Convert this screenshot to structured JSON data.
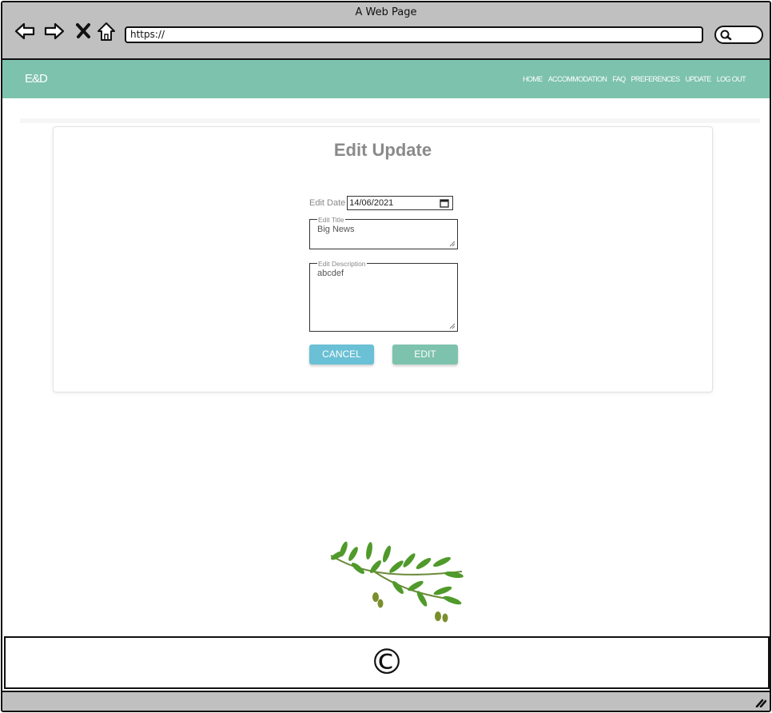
{
  "window": {
    "title": "A Web Page"
  },
  "browser": {
    "url": "https://",
    "icons": [
      "back-arrow-icon",
      "forward-arrow-icon",
      "close-x-icon",
      "home-icon",
      "search-icon"
    ]
  },
  "navbar": {
    "brand": "E&D",
    "items": [
      {
        "label": "HOME"
      },
      {
        "label": "ACCOMMODATION"
      },
      {
        "label": "FAQ"
      },
      {
        "label": "PREFERENCES"
      },
      {
        "label": "UPDATE"
      },
      {
        "label": "LOG OUT"
      }
    ],
    "color": "#7dc2ad"
  },
  "form": {
    "title": "Edit Update",
    "date_label": "Edit Date",
    "date_value": "14/06/2021",
    "title_label": "Edit Title",
    "title_value": "Big News",
    "description_label": "Edit Description",
    "description_value": "abcdef",
    "cancel_label": "CANCEL",
    "edit_label": "EDIT",
    "cancel_color": "#6ac0d4",
    "edit_color": "#7dc2ad"
  },
  "footer": {
    "symbol": "©"
  }
}
